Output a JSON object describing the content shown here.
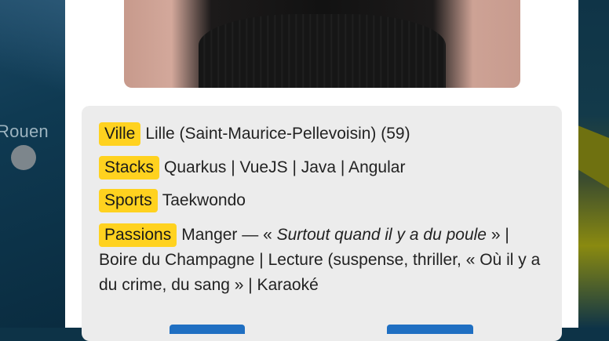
{
  "map": {
    "city_label": "Rouen"
  },
  "profile": {
    "ville": {
      "label": "Ville",
      "value": "Lille (Saint-Maurice-Pellevoisin) (59)"
    },
    "stacks": {
      "label": "Stacks",
      "value": "Quarkus | VueJS | Java | Angular"
    },
    "sports": {
      "label": "Sports",
      "value": "Taekwondo"
    },
    "passions": {
      "label": "Passions",
      "before": "Manger — « ",
      "italic": "Surtout quand il y a du poule",
      "after": " » | Boire du Champagne | Lecture (suspense, thriller, « Où il y a du crime, du sang » | Karaoké"
    }
  },
  "colors": {
    "tag": "#ffd21f",
    "card": "#ececec",
    "button": "#1f6fc2"
  }
}
